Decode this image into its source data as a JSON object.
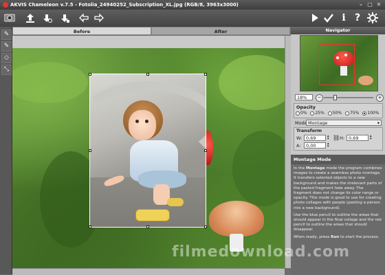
{
  "window": {
    "title": "AKVIS Chameleon v.7.5 - Fotolia_24940252_Subscription_XL.jpg (RGB/8, 3963x3000)",
    "controls": [
      "–",
      "□",
      "✕"
    ]
  },
  "toolbar": {
    "left_icons": [
      "open-icon",
      "save-icon",
      "settings-icon",
      "export-icon",
      "undo-icon",
      "redo-icon"
    ],
    "right_icons": [
      "run-icon",
      "apply-icon",
      "info-icon",
      "help-icon",
      "preferences-icon"
    ]
  },
  "tabs": {
    "before": "Before",
    "after": "After"
  },
  "navigator": {
    "title": "Navigator",
    "zoom": "18%"
  },
  "opacity": {
    "title": "Opacity",
    "options": [
      "0%",
      "25%",
      "50%",
      "75%",
      "100%"
    ],
    "selected": "100%"
  },
  "mode": {
    "label": "Mode",
    "value": "Montage"
  },
  "transform": {
    "title": "Transform",
    "w_label": "W:",
    "w_value": "0,69",
    "h_label": "H:",
    "h_value": "0,69",
    "a_label": "A:",
    "a_value": "0,00"
  },
  "help": {
    "title": "Montage Mode",
    "p1_prefix": "In the ",
    "p1_bold": "Montage",
    "p1_rest": " mode the program combines images to create a seamless photo montage. It transfers selected objects to a new background and makes the irrelevant parts of the pasted fragment fade away. The fragment does not change its color range or opacity. This mode is good to use for creating photo collages with people (pasting a person into a new background).",
    "p2": "Use the blue pencil to outline the areas that should appear in the final collage and the red pencil to outline the areas that should disappear.",
    "p3_prefix": "When ready, press ",
    "p3_bold": "Run",
    "p3_rest": " to start the process."
  },
  "watermark": "filmedownload.com",
  "colors": {
    "accent_red": "#e03a2a",
    "frame_red": "#ff2a2a",
    "panel_bg": "#c7c7c7"
  }
}
